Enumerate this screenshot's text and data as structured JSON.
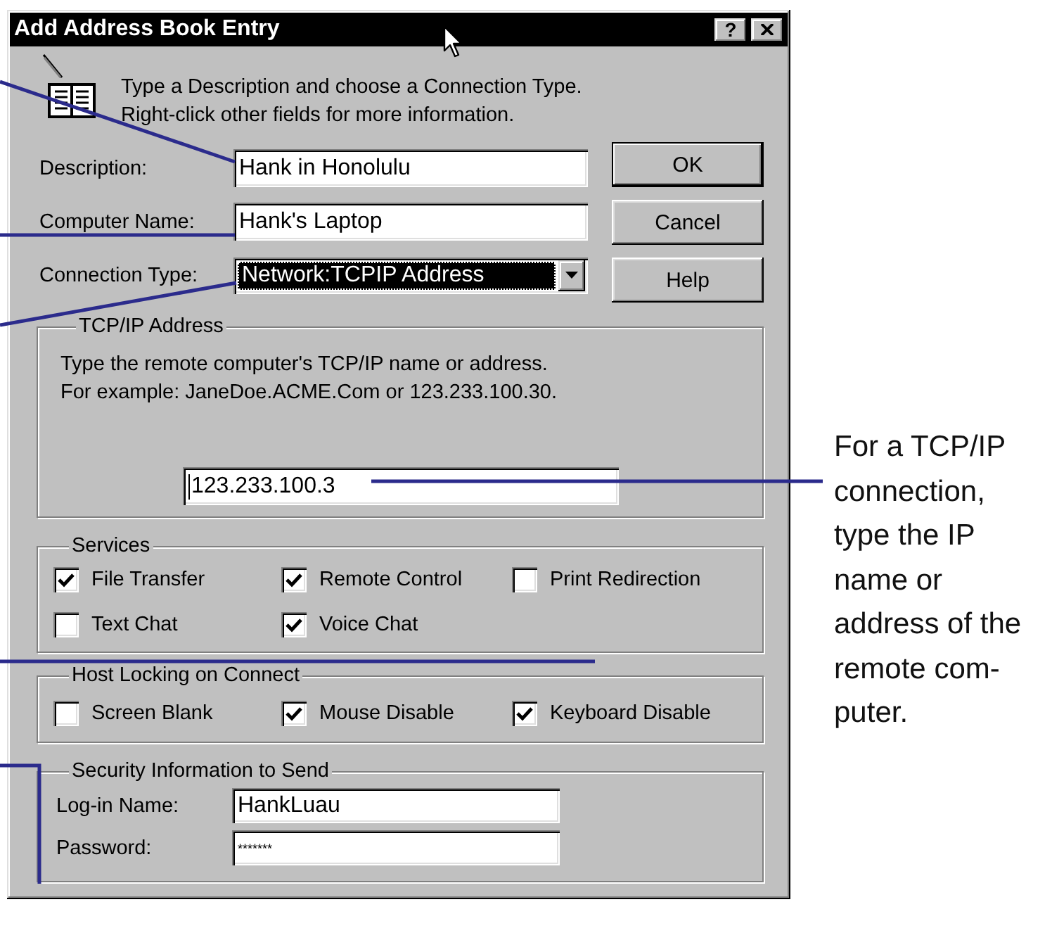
{
  "window": {
    "title": "Add Address Book Entry",
    "help_button": "?"
  },
  "intro": {
    "lines": [
      "Type a Description and choose a Connection Type.",
      "Right-click other fields for more information."
    ]
  },
  "fields": [
    {
      "kind": "text",
      "label": "Description:",
      "value": "Hank in Honolulu"
    },
    {
      "kind": "text",
      "label": "Computer Name:",
      "value": "Hank's Laptop"
    },
    {
      "kind": "dropdown",
      "label": "Connection Type:",
      "value": "Network:TCPIP Address",
      "highlighted": true
    }
  ],
  "buttons": [
    {
      "label": "OK",
      "default": true
    },
    {
      "label": "Cancel",
      "default": false
    },
    {
      "label": "Help",
      "default": false
    }
  ],
  "tcpip_address": {
    "title": "TCP/IP Address",
    "hint_lines": [
      "Type the remote computer's TCP/IP name or address.",
      "For example: JaneDoe.ACME.Com or 123.233.100.30."
    ],
    "value": "123.233.100.3",
    "text_cursor": true
  },
  "services": {
    "title": "Services",
    "options": [
      {
        "label": "File Transfer",
        "checked": true
      },
      {
        "label": "Remote Control",
        "checked": true
      },
      {
        "label": "Print Redirection",
        "checked": false
      },
      {
        "label": "Text Chat",
        "checked": false
      },
      {
        "label": "Voice Chat",
        "checked": true
      }
    ]
  },
  "host_locking": {
    "title": "Host Locking on Connect",
    "options": [
      {
        "label": "Screen Blank",
        "checked": false
      },
      {
        "label": "Mouse Disable",
        "checked": true
      },
      {
        "label": "Keyboard Disable",
        "checked": true
      }
    ]
  },
  "security": {
    "title": "Security Information to Send",
    "fields": [
      {
        "label": "Log-in Name:",
        "value": "HankLuau"
      },
      {
        "label": "Password:",
        "value": "*******"
      }
    ]
  },
  "annotation": {
    "lines": [
      "For a TCP/IP",
      "connection,",
      "type the IP",
      "name or",
      "address of the",
      "remote com-",
      "puter."
    ]
  }
}
